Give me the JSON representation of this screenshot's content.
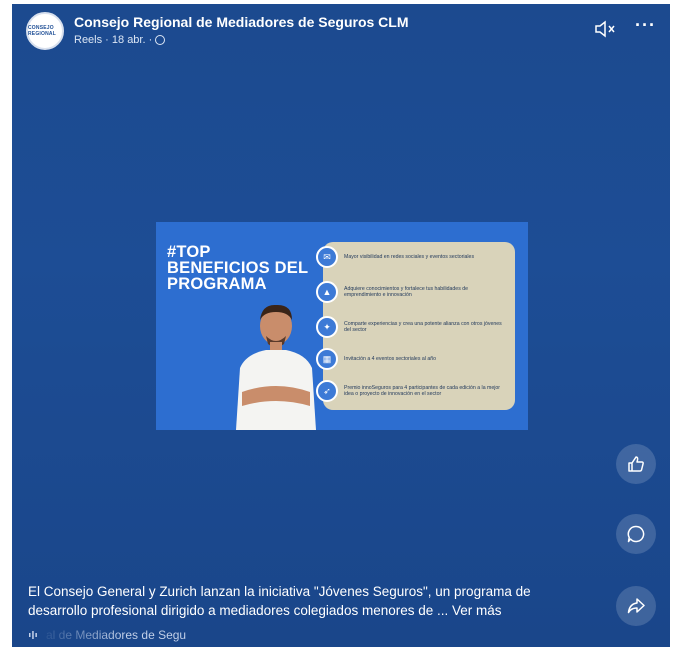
{
  "post": {
    "page_name": "Consejo Regional de Mediadores de Seguros CLM",
    "meta": "Reels · 18 abr. ·",
    "avatar_text": "CONSEJO REGIONAL"
  },
  "media": {
    "title_line1": "#TOP",
    "title_line2": "BENEFICIOS DEL",
    "title_line3": "PROGRAMA",
    "benefits": [
      "Mayor visibilidad en redes sociales y eventos sectoriales",
      "Adquiere conocimientos y fortalece tus habilidades de emprendimiento e innovación",
      "Comparte experiencias y crea una potente alianza con otros jóvenes del sector",
      "Invitación a 4 eventos sectoriales al año",
      "Premio innoSeguros para 4 participantes de cada edición a la mejor idea o proyecto de innovación en el sector"
    ]
  },
  "caption": {
    "text": "El Consejo General y Zurich lanzan la iniciativa \"Jóvenes Seguros\", un programa de desarrollo profesional dirigido a mediadores colegiados menores de ...",
    "see_more": "Ver más"
  },
  "audio": {
    "label": "al de Mediadores de Segu"
  },
  "icons": {
    "mute": "speaker-muted-icon",
    "more": "more-options-icon",
    "like": "thumbs-up-icon",
    "comment": "comment-bubble-icon",
    "share": "share-arrow-icon",
    "audio": "audio-wave-icon"
  }
}
